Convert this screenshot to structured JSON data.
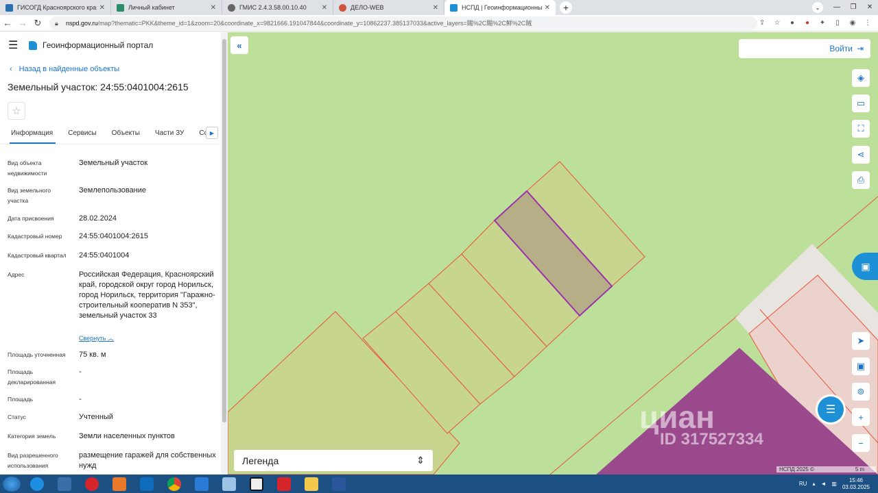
{
  "browser": {
    "tabs": [
      {
        "title": "ГИСОГД Красноярского края",
        "favicon_color": "#2a6fb0",
        "active": false
      },
      {
        "title": "Личный кабинет",
        "favicon_color": "#2a8c6a",
        "active": false
      },
      {
        "title": "ГМИС 2.4.3.58.00.10.40",
        "favicon_color": "#666666",
        "active": false
      },
      {
        "title": "ДЕЛО-WEB",
        "favicon_color": "#d0563b",
        "active": false
      },
      {
        "title": "НСПД | Геоинформационный п",
        "favicon_color": "#1e90d6",
        "active": true
      }
    ],
    "url_host": "nspd.gov.ru",
    "url_path": "/map?thematic=PKK&theme_id=1&zoom=20&coordinate_x=9821666.191047844&coordinate_y=10862237.385137033&active_layers=賜%2C賜%2C鮮%2C賊"
  },
  "app": {
    "title": "Геоинформационный портал",
    "back_label": "Назад в найденные объекты",
    "object_title": "Земельный участок: 24:55:0401004:2615",
    "tabs": [
      "Информация",
      "Сервисы",
      "Объекты",
      "Части ЗУ",
      "Соста"
    ],
    "collapse_label": "Свернуть",
    "properties": [
      {
        "key": "Вид объекта недвижимости",
        "value": "Земельный участок"
      },
      {
        "key": "Вид земельного участка",
        "value": "Землепользование"
      },
      {
        "key": "Дата присвоения",
        "value": "28.02.2024"
      },
      {
        "key": "Кадастровый номер",
        "value": "24:55:0401004:2615"
      },
      {
        "key": "Кадастровый квартал",
        "value": "24:55:0401004"
      },
      {
        "key": "Адрес",
        "value": "Российская Федерация, Красноярский край, городской округ город Норильск, город Норильск, территория \"Гаражно-строительный кооператив N 353\", земельный участок 33"
      },
      {
        "key": "Площадь уточненная",
        "value": "75 кв. м"
      },
      {
        "key": "Площадь декларированная",
        "value": "-"
      },
      {
        "key": "Площадь",
        "value": "-"
      },
      {
        "key": "Статус",
        "value": "Учтенный"
      },
      {
        "key": "Категория земель",
        "value": "Земли населенных пунктов"
      },
      {
        "key": "Вид разрешенного использования",
        "value": "размещение гаражей для собственных нужд"
      }
    ]
  },
  "map": {
    "login_label": "Войти",
    "legend_label": "Легенда",
    "copyright": "НСПД 2025 ©",
    "scale_label": "5 m",
    "watermark": "циан",
    "watermark_id": "ID 317527334",
    "tools": [
      "layers-icon",
      "ruler-icon",
      "select-area-icon",
      "share-icon",
      "print-icon"
    ],
    "colors": {
      "background": "#bcdf99",
      "parcel_fill": "#c7d58f",
      "selected_fill": "#b5ae86",
      "selected_stroke": "#9b2fae",
      "boundary": "#e8553a",
      "purple_zone": "#9a4a8c",
      "pink_zone": "#ecd2cc"
    }
  },
  "taskbar": {
    "lang": "RU",
    "time": "15:46",
    "date": "03.03.2025"
  }
}
